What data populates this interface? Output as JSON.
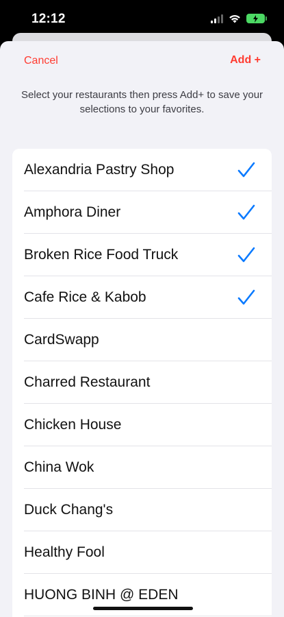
{
  "status_bar": {
    "time": "12:12",
    "battery_level": "charging"
  },
  "nav": {
    "cancel_label": "Cancel",
    "add_label": "Add +"
  },
  "instructions": "Select your restaurants then press Add+ to save your selections to your favorites.",
  "restaurants": [
    {
      "name": "Alexandria Pastry Shop",
      "selected": true
    },
    {
      "name": "Amphora Diner",
      "selected": true
    },
    {
      "name": "Broken Rice Food Truck",
      "selected": true
    },
    {
      "name": "Cafe Rice & Kabob",
      "selected": true
    },
    {
      "name": "CardSwapp",
      "selected": false
    },
    {
      "name": "Charred Restaurant",
      "selected": false
    },
    {
      "name": "Chicken House",
      "selected": false
    },
    {
      "name": "China Wok",
      "selected": false
    },
    {
      "name": "Duck Chang's",
      "selected": false
    },
    {
      "name": "Healthy Fool",
      "selected": false
    },
    {
      "name": "HUONG BINH @ EDEN",
      "selected": false
    }
  ],
  "colors": {
    "accent": "#ff3b30",
    "check": "#0a7aff",
    "background": "#f2f2f7"
  }
}
